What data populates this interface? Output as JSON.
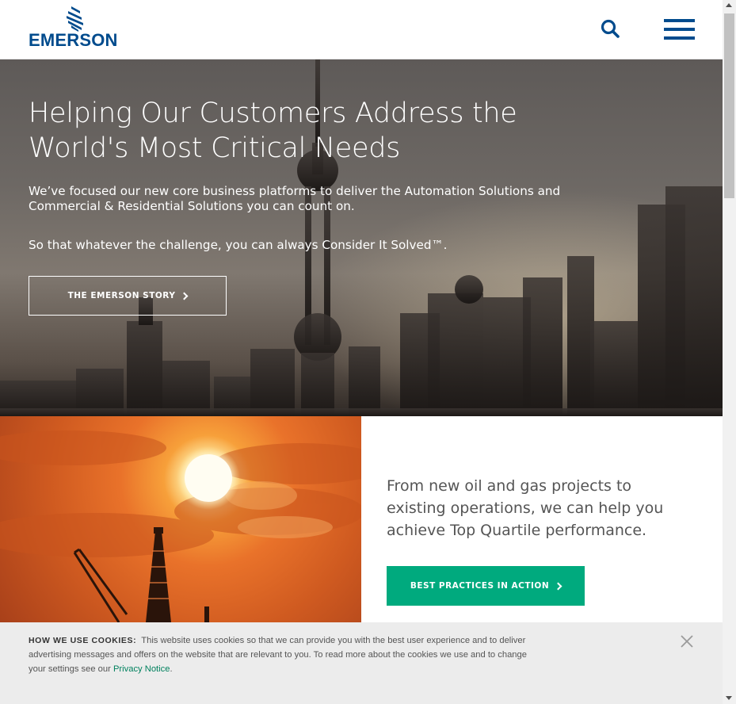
{
  "header": {
    "logo_text": "EMERSON",
    "search_icon": "search-icon",
    "menu_icon": "hamburger-menu-icon"
  },
  "hero": {
    "title": "Helping Our Customers Address the World's Most Critical Needs",
    "paragraph1": "We’ve focused our new core business platforms to deliver the Automation Solutions and Commercial & Residential Solutions you can count on.",
    "paragraph2": "So that whatever the challenge, you can always Consider It Solved™.",
    "button_label": "THE EMERSON STORY"
  },
  "feature": {
    "text": "From new oil and gas projects to existing operations, we can help you achieve Top Quartile performance.",
    "button_label": "BEST PRACTICES IN ACTION"
  },
  "cookie": {
    "heading": "HOW WE USE COOKIES:",
    "body": "This website uses cookies so that we can provide you with the best user experience and to deliver advertising messages and offers on the website that are relevant to you. To read more about the cookies we use and to change your settings see our",
    "link": "Privacy Notice",
    "end": ".",
    "close_icon": "close-icon"
  },
  "colors": {
    "brand_blue": "#004b8d",
    "cta_green": "#00aa7e",
    "link_green": "#00815e"
  }
}
